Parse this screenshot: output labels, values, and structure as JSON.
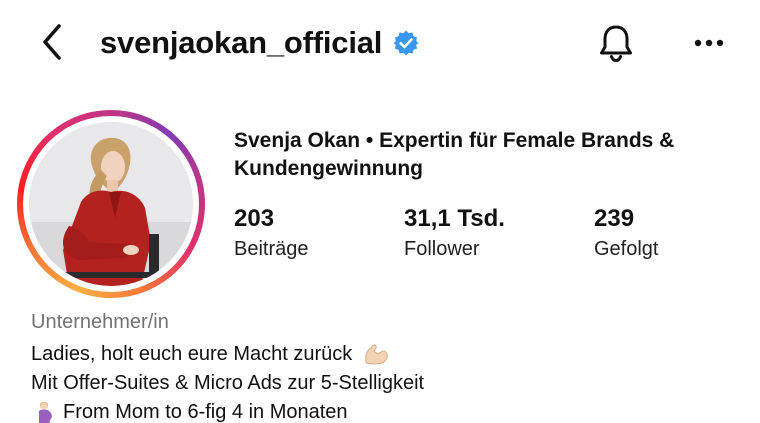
{
  "header": {
    "username": "svenjaokan_official",
    "verified": true,
    "icons": {
      "back": "chevron-left-icon",
      "verified": "verified-badge-icon",
      "notifications": "bell-icon",
      "more": "more-horizontal-icon"
    }
  },
  "profile": {
    "display_name": "Svenja Okan • Expertin für Female Brands & Kundengewinnung",
    "stats": {
      "posts": {
        "value": "203",
        "label": "Beiträge"
      },
      "followers": {
        "value": "31,1 Tsd.",
        "label": "Follower"
      },
      "following": {
        "value": "239",
        "label": "Gefolgt"
      }
    }
  },
  "bio": {
    "category": "Unternehmer/in",
    "line1": "Ladies, holt euch eure Macht zurück",
    "line1_emoji": "flexed-biceps-emoji",
    "line2": "Mit Offer-Suites & Micro Ads zur 5-Stelligkeit",
    "line3_emoji": "pregnant-woman-emoji",
    "line3": "From Mom to 6-fig 4 in Monaten"
  },
  "colors": {
    "verified_blue": "#3897f0",
    "category_gray": "#737373",
    "ring_gradient": [
      "#fcaf45",
      "#f77737",
      "#fd1d1d",
      "#e1306c",
      "#c13584",
      "#833ab4"
    ]
  }
}
